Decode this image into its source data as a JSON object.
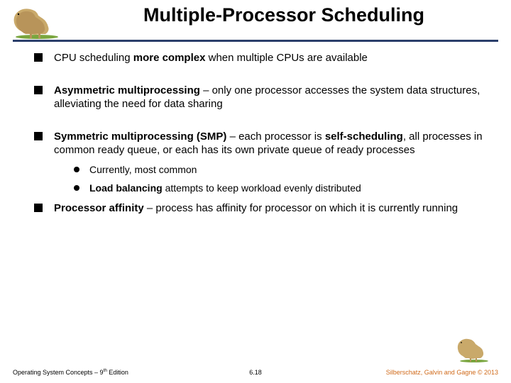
{
  "title": "Multiple-Processor Scheduling",
  "bullets": [
    {
      "parts": [
        {
          "t": "CPU scheduling ",
          "b": false
        },
        {
          "t": "more complex",
          "b": true
        },
        {
          "t": " when multiple CPUs are available",
          "b": false
        }
      ]
    },
    {
      "parts": [
        {
          "t": "Asymmetric multiprocessing",
          "b": true
        },
        {
          "t": " – only one processor accesses the system data structures, alleviating the need for data sharing",
          "b": false
        }
      ]
    },
    {
      "parts": [
        {
          "t": "Symmetric multiprocessing (SMP)",
          "b": true
        },
        {
          "t": " – each processor is ",
          "b": false
        },
        {
          "t": "self-scheduling",
          "b": true
        },
        {
          "t": ", all processes in common ready queue, or each has its own private queue of ready processes",
          "b": false
        }
      ],
      "sub": [
        {
          "parts": [
            {
              "t": "Currently, most common",
              "b": false
            }
          ]
        },
        {
          "parts": [
            {
              "t": "Load balancing",
              "b": true
            },
            {
              "t": " attempts to keep workload evenly distributed",
              "b": false
            }
          ]
        }
      ]
    },
    {
      "parts": [
        {
          "t": "Processor affinity",
          "b": true
        },
        {
          "t": " – process has affinity for processor on which it is currently running",
          "b": false
        }
      ]
    }
  ],
  "footer": {
    "left_pre": "Operating System Concepts – 9",
    "left_sup": "th",
    "left_post": " Edition",
    "center": "6.18",
    "right": "Silberschatz, Galvin and Gagne © 2013"
  }
}
